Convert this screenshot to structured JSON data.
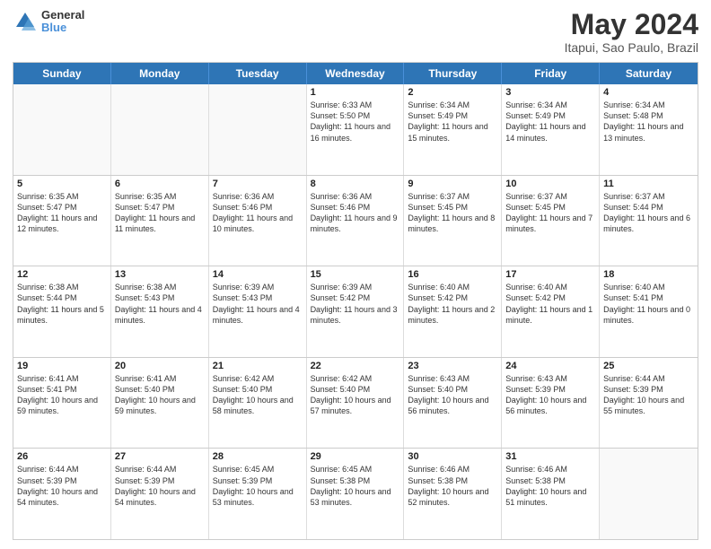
{
  "header": {
    "logo_line1": "General",
    "logo_line2": "Blue",
    "main_title": "May 2024",
    "subtitle": "Itapui, Sao Paulo, Brazil"
  },
  "days": [
    "Sunday",
    "Monday",
    "Tuesday",
    "Wednesday",
    "Thursday",
    "Friday",
    "Saturday"
  ],
  "weeks": [
    [
      {
        "day": "",
        "text": ""
      },
      {
        "day": "",
        "text": ""
      },
      {
        "day": "",
        "text": ""
      },
      {
        "day": "1",
        "text": "Sunrise: 6:33 AM\nSunset: 5:50 PM\nDaylight: 11 hours and 16 minutes."
      },
      {
        "day": "2",
        "text": "Sunrise: 6:34 AM\nSunset: 5:49 PM\nDaylight: 11 hours and 15 minutes."
      },
      {
        "day": "3",
        "text": "Sunrise: 6:34 AM\nSunset: 5:49 PM\nDaylight: 11 hours and 14 minutes."
      },
      {
        "day": "4",
        "text": "Sunrise: 6:34 AM\nSunset: 5:48 PM\nDaylight: 11 hours and 13 minutes."
      }
    ],
    [
      {
        "day": "5",
        "text": "Sunrise: 6:35 AM\nSunset: 5:47 PM\nDaylight: 11 hours and 12 minutes."
      },
      {
        "day": "6",
        "text": "Sunrise: 6:35 AM\nSunset: 5:47 PM\nDaylight: 11 hours and 11 minutes."
      },
      {
        "day": "7",
        "text": "Sunrise: 6:36 AM\nSunset: 5:46 PM\nDaylight: 11 hours and 10 minutes."
      },
      {
        "day": "8",
        "text": "Sunrise: 6:36 AM\nSunset: 5:46 PM\nDaylight: 11 hours and 9 minutes."
      },
      {
        "day": "9",
        "text": "Sunrise: 6:37 AM\nSunset: 5:45 PM\nDaylight: 11 hours and 8 minutes."
      },
      {
        "day": "10",
        "text": "Sunrise: 6:37 AM\nSunset: 5:45 PM\nDaylight: 11 hours and 7 minutes."
      },
      {
        "day": "11",
        "text": "Sunrise: 6:37 AM\nSunset: 5:44 PM\nDaylight: 11 hours and 6 minutes."
      }
    ],
    [
      {
        "day": "12",
        "text": "Sunrise: 6:38 AM\nSunset: 5:44 PM\nDaylight: 11 hours and 5 minutes."
      },
      {
        "day": "13",
        "text": "Sunrise: 6:38 AM\nSunset: 5:43 PM\nDaylight: 11 hours and 4 minutes."
      },
      {
        "day": "14",
        "text": "Sunrise: 6:39 AM\nSunset: 5:43 PM\nDaylight: 11 hours and 4 minutes."
      },
      {
        "day": "15",
        "text": "Sunrise: 6:39 AM\nSunset: 5:42 PM\nDaylight: 11 hours and 3 minutes."
      },
      {
        "day": "16",
        "text": "Sunrise: 6:40 AM\nSunset: 5:42 PM\nDaylight: 11 hours and 2 minutes."
      },
      {
        "day": "17",
        "text": "Sunrise: 6:40 AM\nSunset: 5:42 PM\nDaylight: 11 hours and 1 minute."
      },
      {
        "day": "18",
        "text": "Sunrise: 6:40 AM\nSunset: 5:41 PM\nDaylight: 11 hours and 0 minutes."
      }
    ],
    [
      {
        "day": "19",
        "text": "Sunrise: 6:41 AM\nSunset: 5:41 PM\nDaylight: 10 hours and 59 minutes."
      },
      {
        "day": "20",
        "text": "Sunrise: 6:41 AM\nSunset: 5:40 PM\nDaylight: 10 hours and 59 minutes."
      },
      {
        "day": "21",
        "text": "Sunrise: 6:42 AM\nSunset: 5:40 PM\nDaylight: 10 hours and 58 minutes."
      },
      {
        "day": "22",
        "text": "Sunrise: 6:42 AM\nSunset: 5:40 PM\nDaylight: 10 hours and 57 minutes."
      },
      {
        "day": "23",
        "text": "Sunrise: 6:43 AM\nSunset: 5:40 PM\nDaylight: 10 hours and 56 minutes."
      },
      {
        "day": "24",
        "text": "Sunrise: 6:43 AM\nSunset: 5:39 PM\nDaylight: 10 hours and 56 minutes."
      },
      {
        "day": "25",
        "text": "Sunrise: 6:44 AM\nSunset: 5:39 PM\nDaylight: 10 hours and 55 minutes."
      }
    ],
    [
      {
        "day": "26",
        "text": "Sunrise: 6:44 AM\nSunset: 5:39 PM\nDaylight: 10 hours and 54 minutes."
      },
      {
        "day": "27",
        "text": "Sunrise: 6:44 AM\nSunset: 5:39 PM\nDaylight: 10 hours and 54 minutes."
      },
      {
        "day": "28",
        "text": "Sunrise: 6:45 AM\nSunset: 5:39 PM\nDaylight: 10 hours and 53 minutes."
      },
      {
        "day": "29",
        "text": "Sunrise: 6:45 AM\nSunset: 5:38 PM\nDaylight: 10 hours and 53 minutes."
      },
      {
        "day": "30",
        "text": "Sunrise: 6:46 AM\nSunset: 5:38 PM\nDaylight: 10 hours and 52 minutes."
      },
      {
        "day": "31",
        "text": "Sunrise: 6:46 AM\nSunset: 5:38 PM\nDaylight: 10 hours and 51 minutes."
      },
      {
        "day": "",
        "text": ""
      }
    ]
  ]
}
